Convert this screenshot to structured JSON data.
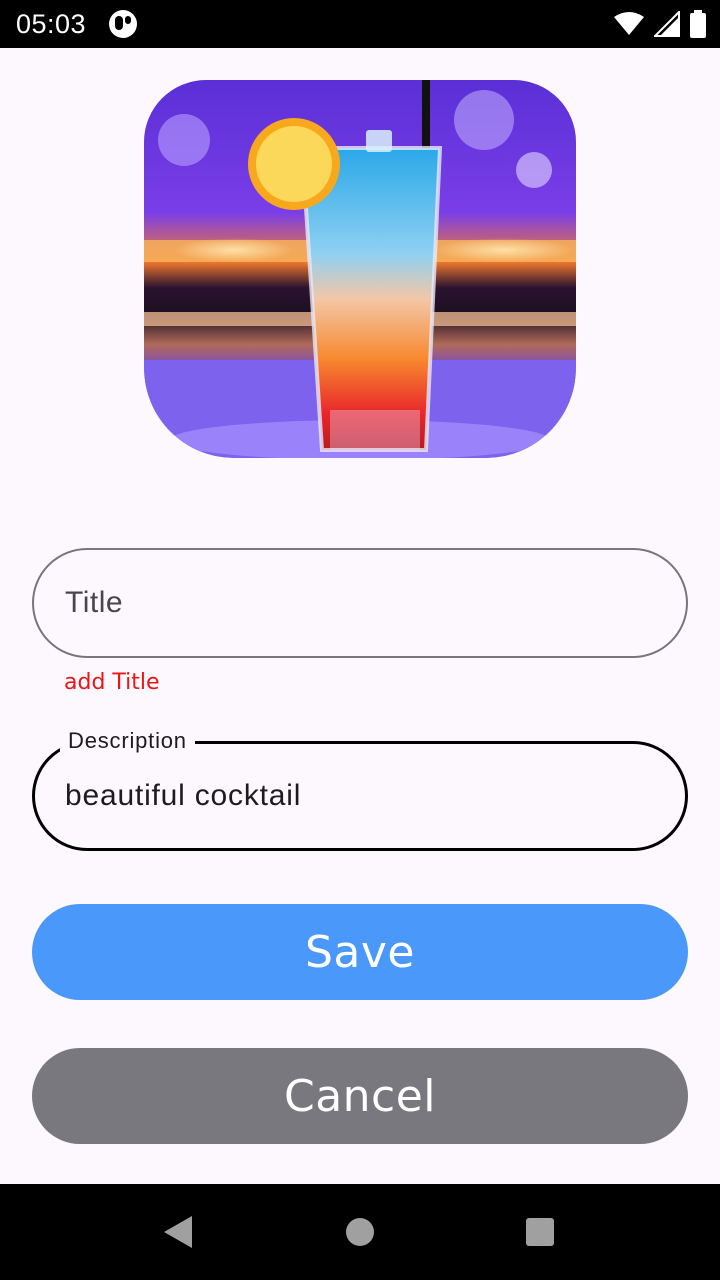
{
  "status_bar": {
    "time": "05:03",
    "icons": [
      "app-notification-icon",
      "wifi-icon",
      "cell-signal-icon",
      "battery-icon"
    ]
  },
  "photo": {
    "subject": "cocktail-photo"
  },
  "form": {
    "title_placeholder": "Title",
    "title_error": "add Title",
    "description_label": "Description",
    "description_value": "beautiful cocktail"
  },
  "buttons": {
    "save_label": "Save",
    "cancel_label": "Cancel"
  },
  "colors": {
    "save": "#4a98fa",
    "cancel": "#7a787f",
    "error": "#e81616",
    "background": "#fdf8fd"
  },
  "nav_bar": {
    "icons": [
      "back-icon",
      "home-icon",
      "recents-icon"
    ]
  }
}
